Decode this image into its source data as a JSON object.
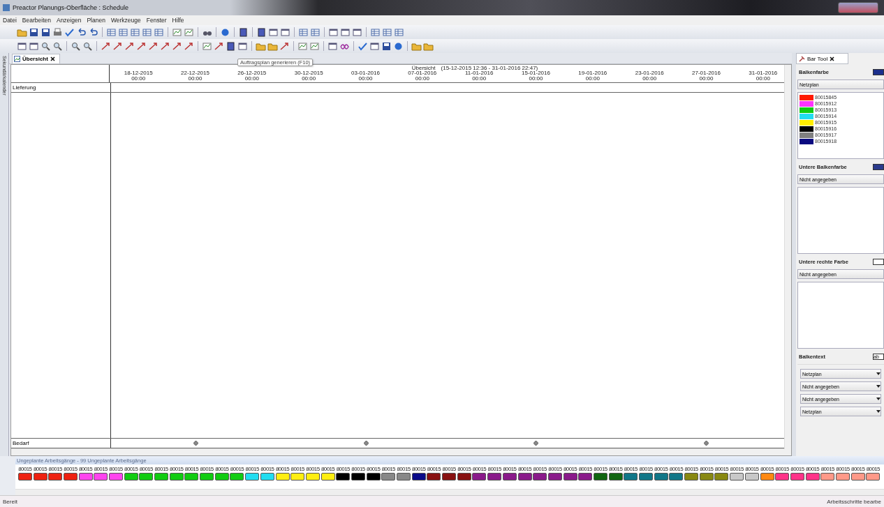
{
  "window": {
    "title": "Preactor Planungs-Oberfläche : Schedule"
  },
  "menu": [
    "Datei",
    "Bearbeiten",
    "Anzeigen",
    "Planen",
    "Werkzeuge",
    "Fenster",
    "Hilfe"
  ],
  "side_tab": "Sekundärkalender",
  "tabs": [
    {
      "label": "Übersicht",
      "selected": true
    }
  ],
  "tooltip": "Auftragsplan generieren (F10)",
  "gantt": {
    "title": "Übersicht",
    "range": "(15-12-2015 12:36 - 31-01-2016 22:47)",
    "ticks": [
      {
        "date": "18-12-2015",
        "time": "00:00"
      },
      {
        "date": "22-12-2015",
        "time": "00:00"
      },
      {
        "date": "26-12-2015",
        "time": "00:00"
      },
      {
        "date": "30-12-2015",
        "time": "00:00"
      },
      {
        "date": "03-01-2016",
        "time": "00:00"
      },
      {
        "date": "07-01-2016",
        "time": "00:00"
      },
      {
        "date": "11-01-2016",
        "time": "00:00"
      },
      {
        "date": "15-01-2016",
        "time": "00:00"
      },
      {
        "date": "19-01-2016",
        "time": "00:00"
      },
      {
        "date": "23-01-2016",
        "time": "00:00"
      },
      {
        "date": "27-01-2016",
        "time": "00:00"
      },
      {
        "date": "31-01-2016",
        "time": "00:00"
      }
    ],
    "top_row": "Lieferung",
    "bottom_row": "Bedarf"
  },
  "bar_tool": {
    "tab": "Bar Tool",
    "bar_color": {
      "label": "Balkenfarbe",
      "color": "#1c2f8c",
      "select": "Netzplan"
    },
    "legend": [
      {
        "code": "80015845",
        "color": "#ff1a00"
      },
      {
        "code": "80015912",
        "color": "#ff33ff"
      },
      {
        "code": "80015913",
        "color": "#11cc11"
      },
      {
        "code": "80015914",
        "color": "#22ddf0"
      },
      {
        "code": "80015915",
        "color": "#ffee00"
      },
      {
        "code": "80015916",
        "color": "#000000"
      },
      {
        "code": "80015917",
        "color": "#808080"
      },
      {
        "code": "80015918",
        "color": "#0a0a80"
      }
    ],
    "lower_color": {
      "label": "Untere Balkenfarbe",
      "color": "#2a3a8c",
      "select": "Nicht angegeben"
    },
    "lower_right_color": {
      "label": "Untere rechte Farbe",
      "select": "Nicht angegeben"
    },
    "bar_text": {
      "label": "Balkentext",
      "sample": "ab"
    },
    "selects": [
      "Netzplan",
      "Nicht angegeben",
      "Nicht angegeben",
      "Netzplan"
    ]
  },
  "unplanned": {
    "title": "Ungeplante Arbeitsgänge - 99 Ungeplante Arbeitsgänge",
    "chips": [
      {
        "label": "80015",
        "color": "#ee2211"
      },
      {
        "label": "80015",
        "color": "#ee2211"
      },
      {
        "label": "80015",
        "color": "#ee2211"
      },
      {
        "label": "80015",
        "color": "#ee2211"
      },
      {
        "label": "80015",
        "color": "#ff44ee"
      },
      {
        "label": "80015",
        "color": "#ff44ee"
      },
      {
        "label": "80015",
        "color": "#ff44ee"
      },
      {
        "label": "80015",
        "color": "#11cc11"
      },
      {
        "label": "80015",
        "color": "#11cc11"
      },
      {
        "label": "80015",
        "color": "#11cc11"
      },
      {
        "label": "80015",
        "color": "#11cc11"
      },
      {
        "label": "80015",
        "color": "#11cc11"
      },
      {
        "label": "80015",
        "color": "#11cc11"
      },
      {
        "label": "80015",
        "color": "#11cc11"
      },
      {
        "label": "80015",
        "color": "#11cc11"
      },
      {
        "label": "80015",
        "color": "#22ddf0"
      },
      {
        "label": "80015",
        "color": "#22ddf0"
      },
      {
        "label": "80015",
        "color": "#ffee11"
      },
      {
        "label": "80015",
        "color": "#ffee11"
      },
      {
        "label": "80015",
        "color": "#ffee11"
      },
      {
        "label": "80015",
        "color": "#ffee11"
      },
      {
        "label": "80015",
        "color": "#000000"
      },
      {
        "label": "80015",
        "color": "#000000"
      },
      {
        "label": "80015",
        "color": "#000000"
      },
      {
        "label": "80015",
        "color": "#888888"
      },
      {
        "label": "80015",
        "color": "#888888"
      },
      {
        "label": "80015",
        "color": "#0a0a88"
      },
      {
        "label": "80015",
        "color": "#881111"
      },
      {
        "label": "80015",
        "color": "#881111"
      },
      {
        "label": "80015",
        "color": "#881111"
      },
      {
        "label": "80015",
        "color": "#8a1a8a"
      },
      {
        "label": "80015",
        "color": "#8a1a8a"
      },
      {
        "label": "80015",
        "color": "#8a1a8a"
      },
      {
        "label": "80015",
        "color": "#8a1a8a"
      },
      {
        "label": "80015",
        "color": "#8a1a8a"
      },
      {
        "label": "80015",
        "color": "#8a1a8a"
      },
      {
        "label": "80015",
        "color": "#8a1a8a"
      },
      {
        "label": "80015",
        "color": "#8a1a8a"
      },
      {
        "label": "80015",
        "color": "#116611"
      },
      {
        "label": "80015",
        "color": "#116611"
      },
      {
        "label": "80015",
        "color": "#117788"
      },
      {
        "label": "80015",
        "color": "#117788"
      },
      {
        "label": "80015",
        "color": "#117788"
      },
      {
        "label": "80015",
        "color": "#117788"
      },
      {
        "label": "80015",
        "color": "#888811"
      },
      {
        "label": "80015",
        "color": "#888811"
      },
      {
        "label": "80015",
        "color": "#888811"
      },
      {
        "label": "80015",
        "color": "#c8c8c8"
      },
      {
        "label": "80015",
        "color": "#c8c8c8"
      },
      {
        "label": "80015",
        "color": "#ff8811"
      },
      {
        "label": "80015",
        "color": "#ff3388"
      },
      {
        "label": "80015",
        "color": "#ff3388"
      },
      {
        "label": "80015",
        "color": "#ff3388"
      },
      {
        "label": "80015",
        "color": "#ff9988"
      },
      {
        "label": "80015",
        "color": "#ff9988"
      },
      {
        "label": "80015",
        "color": "#ff9988"
      },
      {
        "label": "80015",
        "color": "#ff9988"
      }
    ]
  },
  "status_bar": {
    "left": "Bereit",
    "right": "Arbeitsschritte bearbe"
  }
}
